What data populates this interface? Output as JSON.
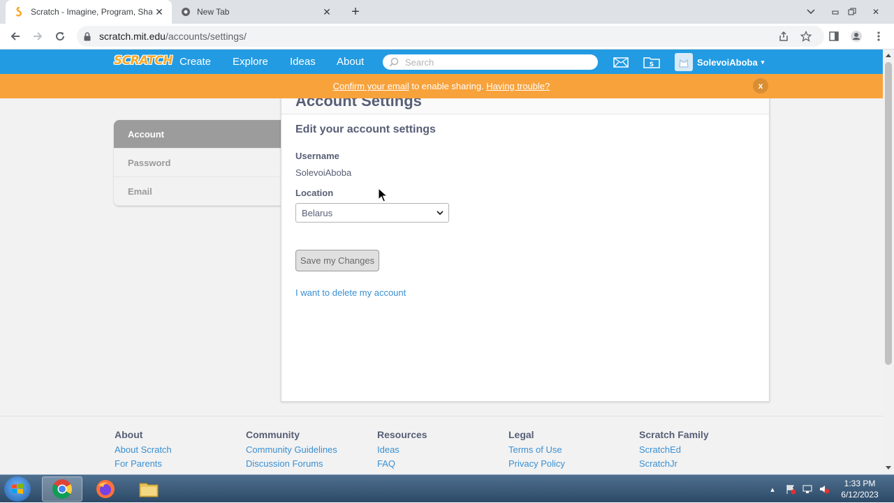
{
  "browser": {
    "tabs": [
      {
        "title": "Scratch - Imagine, Program, Share",
        "active": true
      },
      {
        "title": "New Tab",
        "active": false
      }
    ],
    "url_host": "scratch.mit.edu",
    "url_path": "/accounts/settings/"
  },
  "nav": {
    "logo": "SCRATCH",
    "links": [
      "Create",
      "Explore",
      "Ideas",
      "About"
    ],
    "search_placeholder": "Search",
    "username": "SolevoiAboba"
  },
  "banner": {
    "confirm_link": "Confirm your email",
    "text": " to enable sharing. ",
    "trouble_link": "Having trouble?",
    "close": "x"
  },
  "sidebar": {
    "items": [
      {
        "label": "Account",
        "active": true
      },
      {
        "label": "Password",
        "active": false
      },
      {
        "label": "Email",
        "active": false
      }
    ]
  },
  "main": {
    "page_title": "Account Settings",
    "heading": "Edit your account settings",
    "username_label": "Username",
    "username_value": "SolevoiAboba",
    "location_label": "Location",
    "location_value": "Belarus",
    "save_button": "Save my Changes",
    "delete_link": "I want to delete my account"
  },
  "footer": {
    "columns": [
      {
        "heading": "About",
        "links": [
          "About Scratch",
          "For Parents"
        ]
      },
      {
        "heading": "Community",
        "links": [
          "Community Guidelines",
          "Discussion Forums"
        ]
      },
      {
        "heading": "Resources",
        "links": [
          "Ideas",
          "FAQ"
        ]
      },
      {
        "heading": "Legal",
        "links": [
          "Terms of Use",
          "Privacy Policy"
        ]
      },
      {
        "heading": "Scratch Family",
        "links": [
          "ScratchEd",
          "ScratchJr"
        ]
      }
    ]
  },
  "taskbar": {
    "time": "1:33 PM",
    "date": "6/12/2023"
  },
  "colors": {
    "scratch_blue": "#229be2",
    "banner_orange": "#f7a23b",
    "link_blue": "#3a8fd1"
  }
}
